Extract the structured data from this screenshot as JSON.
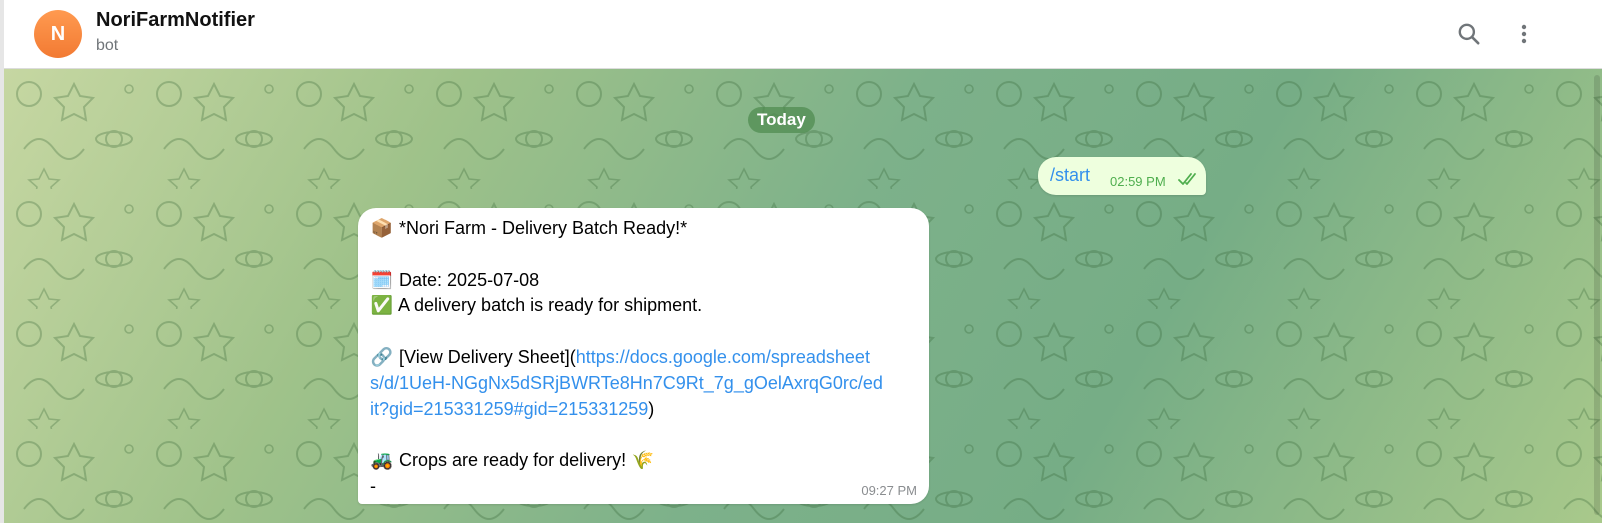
{
  "header": {
    "avatar_initial": "N",
    "chat_name": "NoriFarmNotifier",
    "chat_status": "bot"
  },
  "chat": {
    "date_separator": "Today",
    "outgoing": {
      "text": "/start",
      "time": "02:59 PM",
      "status": "read"
    },
    "incoming": {
      "title": "*Nori Farm - Delivery Batch Ready!*",
      "title_emoji": "📦",
      "date_emoji": "🗓️",
      "date_line": "Date: 2025-07-08",
      "check_emoji": "✅",
      "ready_line": "A delivery batch is ready for shipment.",
      "link_emoji": "🔗",
      "link_prefix": "[View Delivery Sheet](",
      "link_line1": "https://docs.google.com/spreadsheet",
      "link_line2": "s/d/1UeH-NGgNx5dSRjBWRTe8Hn7C9Rt_7g_gOelAxrqG0rc/ed",
      "link_line3": "it?gid=215331259#gid=215331259",
      "link_suffix": ")",
      "tractor_emoji": "🚜",
      "crops_line": "Crops are ready for delivery!",
      "crop_emoji": "🌾",
      "dash_line": "-",
      "time": "09:27 PM"
    }
  },
  "colors": {
    "accent": "#3390ec",
    "outgoing_bubble": "#eeffde",
    "outgoing_time": "#4fae4e",
    "avatar": "#f58a3f"
  },
  "icons": {
    "search": "search-icon",
    "menu": "more-vertical-icon",
    "read": "double-check-icon"
  }
}
